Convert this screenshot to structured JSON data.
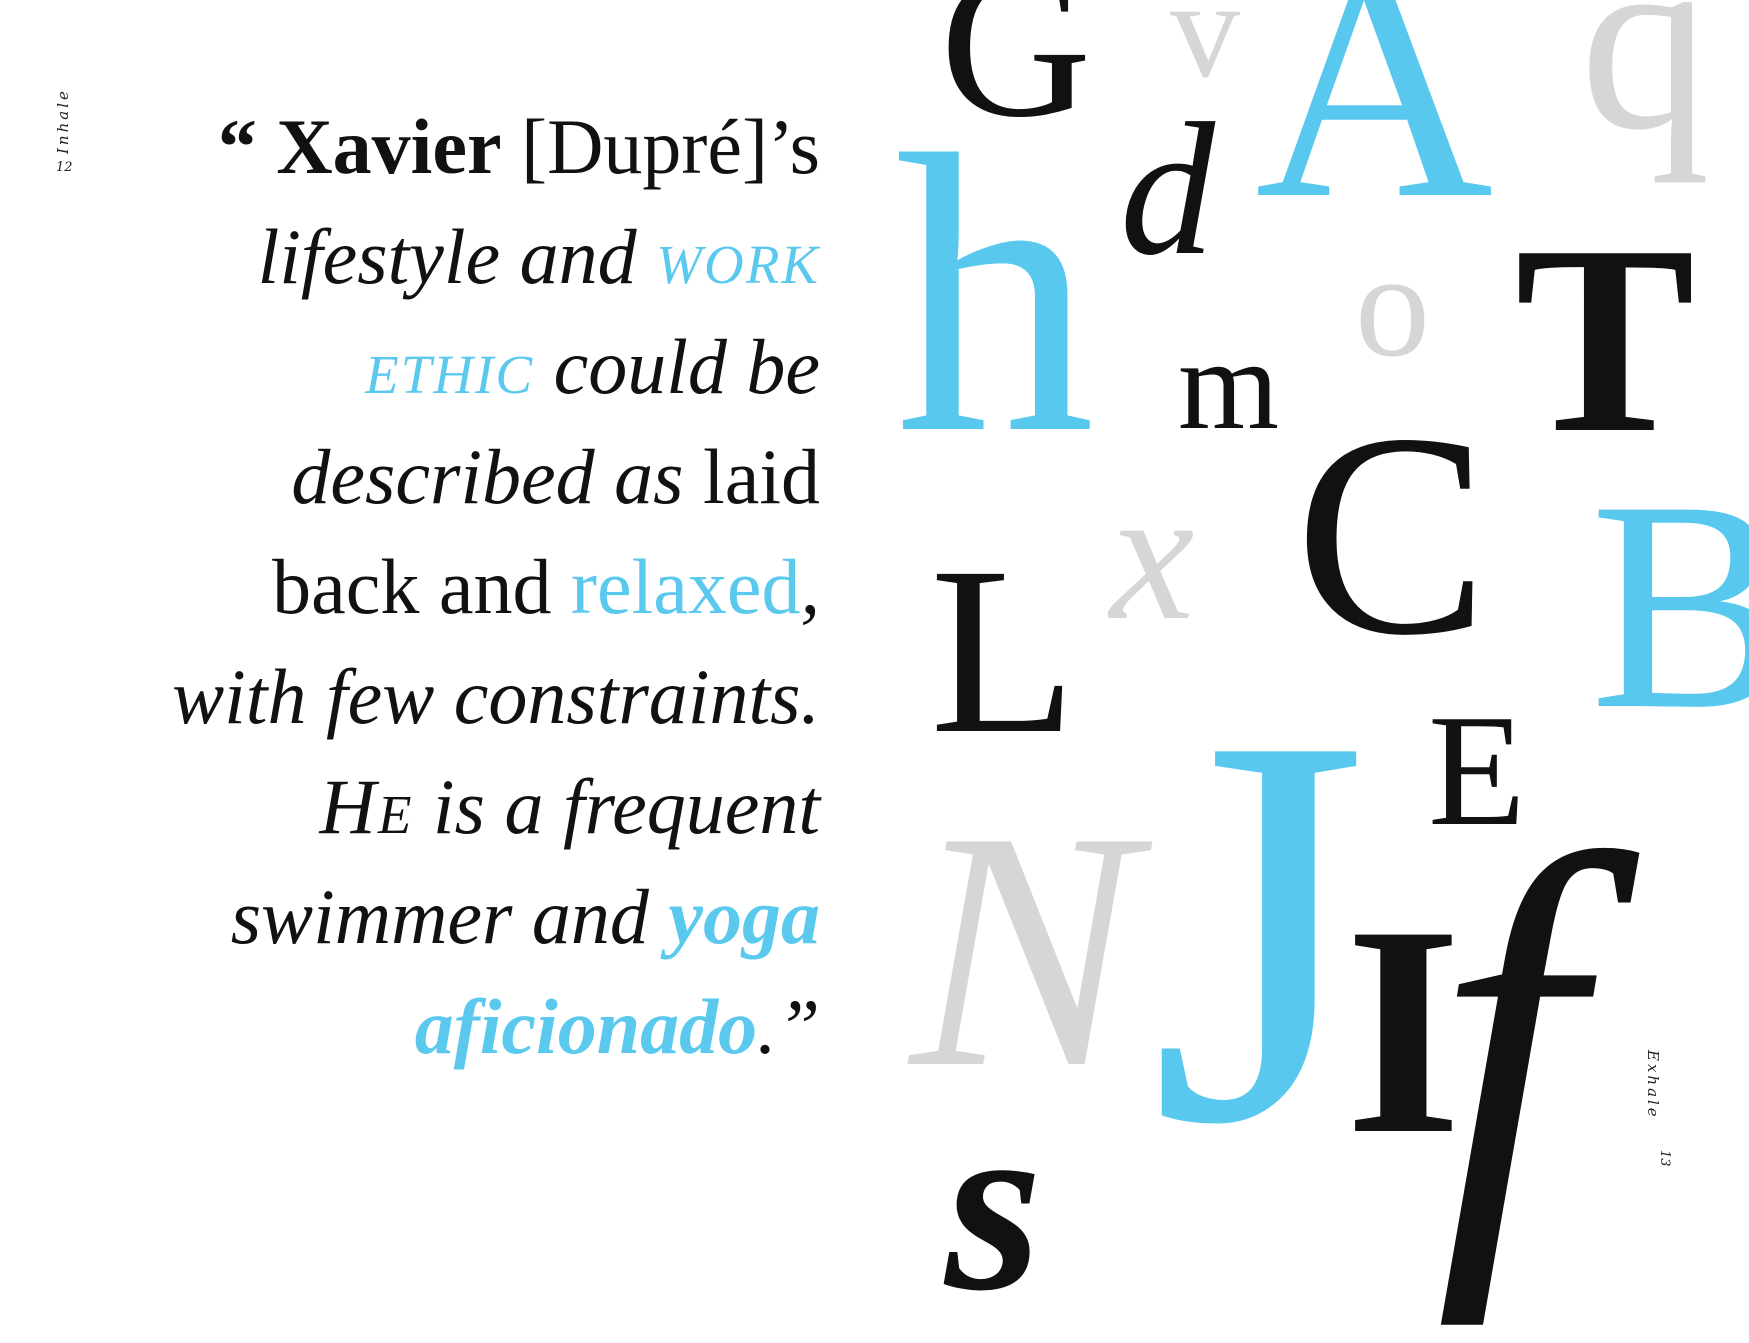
{
  "left_page": {
    "runner": "Inhale",
    "page_number": "12",
    "quote": {
      "l1_open": "“ ",
      "l1_name": "Xavier",
      "l1_rest": " [Dupré]’s",
      "l2_a": "lifestyle and ",
      "l2_b": "work",
      "l3_a": "ethic",
      "l3_b": " could be",
      "l4_a": "described as",
      "l4_b": " laid",
      "l5_a": "back and ",
      "l5_b": "relaxed",
      "l5_c": ",",
      "l6": "with few constraints.",
      "l7_a": "He",
      "l7_b": " is a frequent",
      "l8_a": "swimmer and ",
      "l8_b": "yoga",
      "l9_a": "aficionado",
      "l9_b": ".”"
    }
  },
  "right_page": {
    "runner": "Exhale",
    "page_number": "13",
    "letters": [
      "G",
      "v",
      "A",
      "q",
      "d",
      "h",
      "o",
      "T",
      "m",
      "C",
      "L",
      "x",
      "B",
      "E",
      "N",
      "J",
      "I",
      "f",
      "s"
    ]
  },
  "colors": {
    "accent": "#5bc8ee",
    "text": "#111111",
    "gray": "#d6d6d6"
  }
}
